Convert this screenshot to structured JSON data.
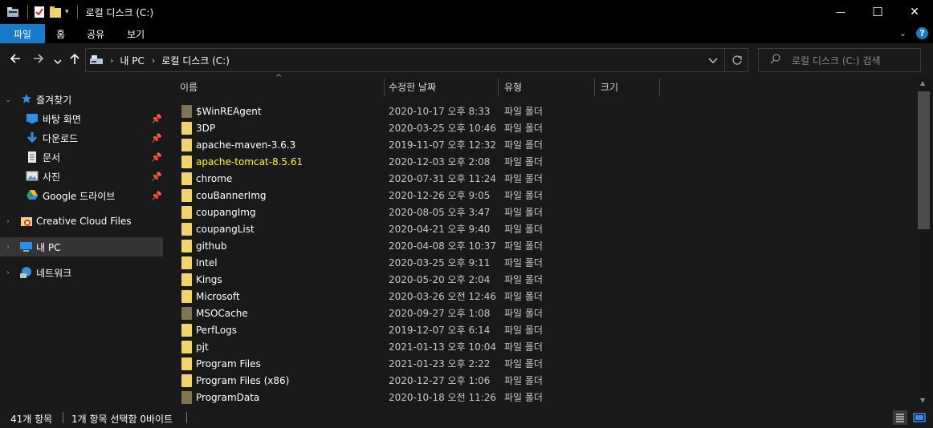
{
  "window": {
    "title": "로컬 디스크 (C:)",
    "minimize_glyph": "—",
    "maximize_glyph": "☐",
    "close_glyph": "✕"
  },
  "ribbon": {
    "tabs": [
      "파일",
      "홈",
      "공유",
      "보기"
    ],
    "help_label": "?"
  },
  "nav": {
    "breadcrumb": [
      "내 PC",
      "로컬 디스크 (C:)"
    ],
    "search_placeholder": "로컬 디스크 (C:) 검색"
  },
  "sidebar": {
    "quick_access_label": "즐겨찾기",
    "quick_items": [
      {
        "label": "바탕 화면",
        "icon": "desktop-icon"
      },
      {
        "label": "다운로드",
        "icon": "download-icon"
      },
      {
        "label": "문서",
        "icon": "document-icon"
      },
      {
        "label": "사진",
        "icon": "pictures-icon"
      },
      {
        "label": "Google 드라이브",
        "icon": "google-drive-icon"
      }
    ],
    "creative_cloud_label": "Creative Cloud Files",
    "this_pc_label": "내 PC",
    "network_label": "네트워크"
  },
  "columns": {
    "name": "이름",
    "modified": "수정한 날짜",
    "type": "유형",
    "size": "크기"
  },
  "files": [
    {
      "name": "$WinREAgent",
      "date": "2020-10-17 오후 8:33",
      "type": "파일 폴더",
      "system": true
    },
    {
      "name": "3DP",
      "date": "2020-03-25 오후 10:46",
      "type": "파일 폴더",
      "system": false
    },
    {
      "name": "apache-maven-3.6.3",
      "date": "2019-11-07 오후 12:32",
      "type": "파일 폴더",
      "system": false
    },
    {
      "name": "apache-tomcat-8.5.61",
      "date": "2020-12-03 오후 2:08",
      "type": "파일 폴더",
      "system": false,
      "highlight": true
    },
    {
      "name": "chrome",
      "date": "2020-07-31 오후 11:24",
      "type": "파일 폴더",
      "system": false
    },
    {
      "name": "couBannerImg",
      "date": "2020-12-26 오후 9:05",
      "type": "파일 폴더",
      "system": false
    },
    {
      "name": "coupangImg",
      "date": "2020-08-05 오후 3:47",
      "type": "파일 폴더",
      "system": false
    },
    {
      "name": "coupangList",
      "date": "2020-04-21 오후 9:40",
      "type": "파일 폴더",
      "system": false
    },
    {
      "name": "github",
      "date": "2020-04-08 오후 10:37",
      "type": "파일 폴더",
      "system": false
    },
    {
      "name": "Intel",
      "date": "2020-03-25 오후 9:11",
      "type": "파일 폴더",
      "system": false
    },
    {
      "name": "Kings",
      "date": "2020-05-20 오후 2:04",
      "type": "파일 폴더",
      "system": false
    },
    {
      "name": "Microsoft",
      "date": "2020-03-26 오전 12:46",
      "type": "파일 폴더",
      "system": false
    },
    {
      "name": "MSOCache",
      "date": "2020-09-27 오후 1:08",
      "type": "파일 폴더",
      "system": true
    },
    {
      "name": "PerfLogs",
      "date": "2019-12-07 오후 6:14",
      "type": "파일 폴더",
      "system": false
    },
    {
      "name": "pjt",
      "date": "2021-01-13 오후 10:04",
      "type": "파일 폴더",
      "system": false
    },
    {
      "name": "Program Files",
      "date": "2021-01-23 오후 2:22",
      "type": "파일 폴더",
      "system": false
    },
    {
      "name": "Program Files (x86)",
      "date": "2020-12-27 오후 1:06",
      "type": "파일 폴더",
      "system": false
    },
    {
      "name": "ProgramData",
      "date": "2020-10-18 오전 11:26",
      "type": "파일 폴더",
      "system": true
    }
  ],
  "status": {
    "item_count": "41개 항목",
    "selection": "1개 항목 선택함 0바이트"
  },
  "colors": {
    "accent": "#1979ca",
    "highlight_text": "#ffff00",
    "folder": "#f5d36c",
    "system_folder": "#7d7650"
  }
}
